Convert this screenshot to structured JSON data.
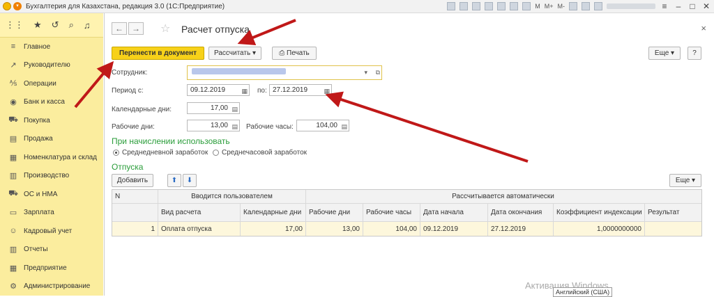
{
  "titlebar": {
    "title": "Бухгалтерия для Казахстана, редакция 3.0  (1С:Предприятие)",
    "mem": "M",
    "mem_plus": "M+",
    "mem_minus": "M-"
  },
  "sidebar": {
    "items": [
      {
        "label": "Главное",
        "icon": "menu-icon"
      },
      {
        "label": "Руководителю",
        "icon": "chart-icon"
      },
      {
        "label": "Операции",
        "icon": "operations-icon"
      },
      {
        "label": "Банк и касса",
        "icon": "bank-icon"
      },
      {
        "label": "Покупка",
        "icon": "cart-icon"
      },
      {
        "label": "Продажа",
        "icon": "sales-icon"
      },
      {
        "label": "Номенклатура и склад",
        "icon": "warehouse-icon"
      },
      {
        "label": "Производство",
        "icon": "factory-icon"
      },
      {
        "label": "ОС и НМА",
        "icon": "truck-icon"
      },
      {
        "label": "Зарплата",
        "icon": "salary-icon"
      },
      {
        "label": "Кадровый учет",
        "icon": "people-icon"
      },
      {
        "label": "Отчеты",
        "icon": "reports-icon"
      },
      {
        "label": "Предприятие",
        "icon": "enterprise-icon"
      },
      {
        "label": "Администрирование",
        "icon": "gear-icon"
      }
    ]
  },
  "form": {
    "title": "Расчет отпуска",
    "btn_transfer": "Перенести в документ",
    "btn_calc": "Рассчитать",
    "btn_print": "Печать",
    "btn_more": "Еще",
    "btn_help": "?",
    "lbl_employee": "Сотрудник:",
    "lbl_period": "Период с:",
    "period_from": "09.12.2019",
    "lbl_to": "по:",
    "period_to": "27.12.2019",
    "lbl_cal_days": "Календарные дни:",
    "cal_days": "17,00",
    "lbl_work_days": "Рабочие дни:",
    "work_days": "13,00",
    "lbl_work_hours": "Рабочие часы:",
    "work_hours": "104,00",
    "section_accrual": "При начислении использовать",
    "radio_daily": "Среднедневной заработок",
    "radio_hourly": "Среднечасовой заработок",
    "section_vacations": "Отпуска",
    "btn_add": "Добавить",
    "btn_more2": "Еще"
  },
  "table": {
    "group_user": "Вводится пользователем",
    "group_auto": "Рассчитывается автоматически",
    "columns": [
      "N",
      "Вид расчета",
      "Календарные дни",
      "Рабочие дни",
      "Рабочие часы",
      "Дата начала",
      "Дата окончания",
      "Коэффициент индексации",
      "Результат"
    ],
    "rows": [
      [
        "1",
        "Оплата отпуска",
        "17,00",
        "13,00",
        "104,00",
        "09.12.2019",
        "27.12.2019",
        "1,0000000000",
        ""
      ]
    ]
  },
  "overlay": {
    "watermark": "Активация Windows",
    "lang": "Английский (США)"
  }
}
